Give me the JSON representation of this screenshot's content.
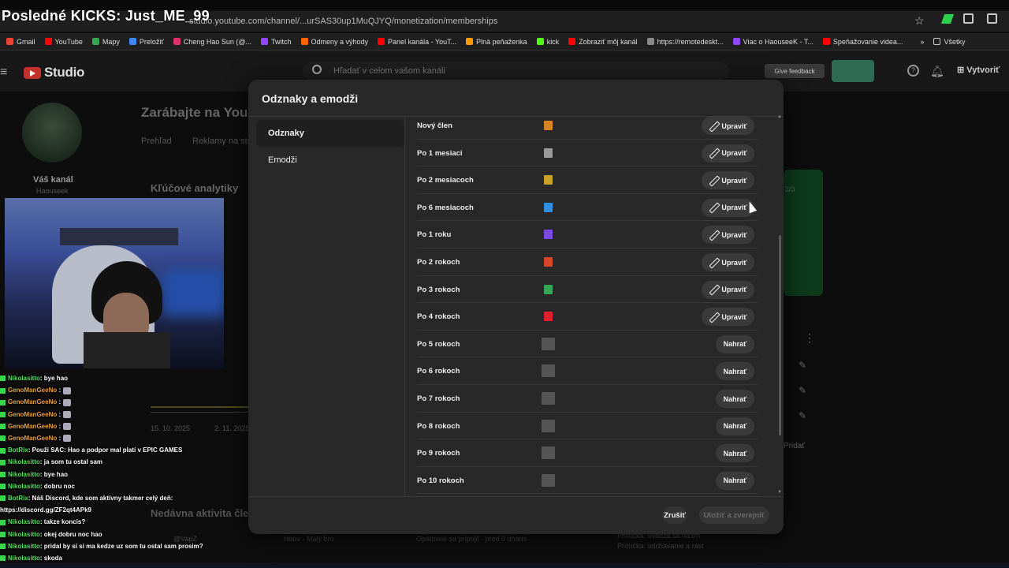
{
  "stream_overlay": {
    "title": "Posledné KICKS: Just_ME_99"
  },
  "browser": {
    "url": "studio.youtube.com/channel/...urSAS30up1MuQJYQ/monetization/memberships",
    "bookmarks": [
      {
        "label": "Gmail",
        "color": "#ea4335"
      },
      {
        "label": "YouTube",
        "color": "#ff0000"
      },
      {
        "label": "Mapy",
        "color": "#34a853"
      },
      {
        "label": "Preložiť",
        "color": "#4285f4"
      },
      {
        "label": "Cheng Hao Sun (@...",
        "color": "#e1306c"
      },
      {
        "label": "Twitch",
        "color": "#9146ff"
      },
      {
        "label": "Odmeny a výhody",
        "color": "#ff6600"
      },
      {
        "label": "Panel kanála - YouT...",
        "color": "#ff0000"
      },
      {
        "label": "Plná peňaženka",
        "color": "#ff9900"
      },
      {
        "label": "kick",
        "color": "#53fc18"
      },
      {
        "label": "Zobraziť môj kanál",
        "color": "#ff0000"
      },
      {
        "label": "https://remotedeskt...",
        "color": "#888888"
      },
      {
        "label": "Viac o HaouseeK - T...",
        "color": "#9146ff"
      },
      {
        "label": "Speňažovanie videa...",
        "color": "#ff0000"
      }
    ],
    "bookmarks_more": "»",
    "bookmarks_folder": "Všetky"
  },
  "studio_header": {
    "logo_text": "Studio",
    "search_placeholder": "Hľadať v celom vašom kanáli",
    "feedback": "Give feedback",
    "create": "Vytvoriť"
  },
  "background_page": {
    "channel_label": "Váš kanál",
    "channel_handle": "Haouseek",
    "title": "Zarábajte na YouTube",
    "tab1": "Prehľad",
    "tab2": "Reklamy na str",
    "analytics": "Kľúčové analytiky",
    "recent_activity": "Nedávna aktivita člena",
    "date1": "15. 10. 2025",
    "date2": "2. 11. 2025",
    "pagination": "3/3",
    "add": "Pridať",
    "footer1": "@VapZ",
    "footer2": "Haov - Malý bro",
    "footer3": "Opätovne sa pripojil · pred 0 dňami",
    "footer4a": "Príručka: uvádza sa na trh",
    "footer4b": "Príručka: udržiavanie a rast"
  },
  "chat": [
    {
      "user": "Nikolasitto",
      "cls": "u-niko",
      "msg": ": bye hao",
      "avatar": false
    },
    {
      "user": "GenoManGeeNo",
      "cls": "u-geno",
      "msg": " :",
      "avatar": true
    },
    {
      "user": "GenoManGeeNo",
      "cls": "u-geno",
      "msg": " :",
      "avatar": true
    },
    {
      "user": "GenoManGeeNo",
      "cls": "u-geno",
      "msg": " :",
      "avatar": true
    },
    {
      "user": "GenoManGeeNo",
      "cls": "u-geno",
      "msg": " :",
      "avatar": true
    },
    {
      "user": "GenoManGeeNo",
      "cls": "u-geno",
      "msg": " :",
      "avatar": true
    },
    {
      "user": "BotRix",
      "cls": "u-bot",
      "msg": ": Použi SAC: Hao a podpor mal platí v EPIC GAMES",
      "avatar": false
    },
    {
      "user": "Nikolasitto",
      "cls": "u-niko",
      "msg": ": ja som tu ostal sam",
      "avatar": false
    },
    {
      "user": "Nikolasitto",
      "cls": "u-niko",
      "msg": ": bye hao",
      "avatar": false
    },
    {
      "user": "Nikolasitto",
      "cls": "u-niko",
      "msg": ": dobru noc",
      "avatar": false
    },
    {
      "user": "BotRix",
      "cls": "u-bot",
      "msg": ": Náš Discord, kde som aktívny takmer celý deň:",
      "avatar": false
    },
    {
      "user": "",
      "cls": "",
      "msg": "https://discord.gg/ZF2qt4APk9",
      "avatar": false
    },
    {
      "user": "Nikolasitto",
      "cls": "u-niko",
      "msg": ": takze koncis?",
      "avatar": false
    },
    {
      "user": "Nikolasitto",
      "cls": "u-niko",
      "msg": ": okej dobru noc hao",
      "avatar": false
    },
    {
      "user": "Nikolasitto",
      "cls": "u-niko",
      "msg": ": pridal by si si ma kedze uz som tu ostal sam prosim?",
      "avatar": false
    },
    {
      "user": "Nikolasitto",
      "cls": "u-niko",
      "msg": ": skoda",
      "avatar": false
    }
  ],
  "modal": {
    "title": "Odznaky a emodži",
    "nav": [
      {
        "label": "Odznaky",
        "active": true
      },
      {
        "label": "Emodži",
        "active": false
      }
    ],
    "badges": [
      {
        "name": "Nový člen",
        "icon": "badge-orange-icon",
        "color": "#d98324",
        "action": "Upraviť"
      },
      {
        "name": "Po 1 mesiaci",
        "icon": "badge-gray-icon",
        "color": "#9a9a9a",
        "action": "Upraviť"
      },
      {
        "name": "Po 2 mesiacoch",
        "icon": "badge-gold-icon",
        "color": "#c9a227",
        "action": "Upraviť"
      },
      {
        "name": "Po 6 mesiacoch",
        "icon": "badge-blue-icon",
        "color": "#2f8fe0",
        "action": "Upraviť"
      },
      {
        "name": "Po 1 roku",
        "icon": "badge-purple-icon",
        "color": "#7a4be0",
        "action": "Upraviť"
      },
      {
        "name": "Po 2 rokoch",
        "icon": "badge-red-icon",
        "color": "#d9452a",
        "action": "Upraviť"
      },
      {
        "name": "Po 3 rokoch",
        "icon": "badge-green-icon",
        "color": "#33a852",
        "action": "Upraviť"
      },
      {
        "name": "Po 4 rokoch",
        "icon": "badge-crimson-icon",
        "color": "#e0202a",
        "action": "Upraviť"
      },
      {
        "name": "Po 5 rokoch",
        "icon": "badge-placeholder-icon",
        "color": "",
        "action": "Nahrať"
      },
      {
        "name": "Po 6 rokoch",
        "icon": "badge-placeholder-icon",
        "color": "",
        "action": "Nahrať"
      },
      {
        "name": "Po 7 rokoch",
        "icon": "badge-placeholder-icon",
        "color": "",
        "action": "Nahrať"
      },
      {
        "name": "Po 8 rokoch",
        "icon": "badge-placeholder-icon",
        "color": "",
        "action": "Nahrať"
      },
      {
        "name": "Po 9 rokoch",
        "icon": "badge-placeholder-icon",
        "color": "",
        "action": "Nahrať"
      },
      {
        "name": "Po 10 rokoch",
        "icon": "badge-placeholder-icon",
        "color": "",
        "action": "Nahrať"
      }
    ],
    "cancel": "Zrušiť",
    "save": "Uložiť a zverejniť"
  }
}
